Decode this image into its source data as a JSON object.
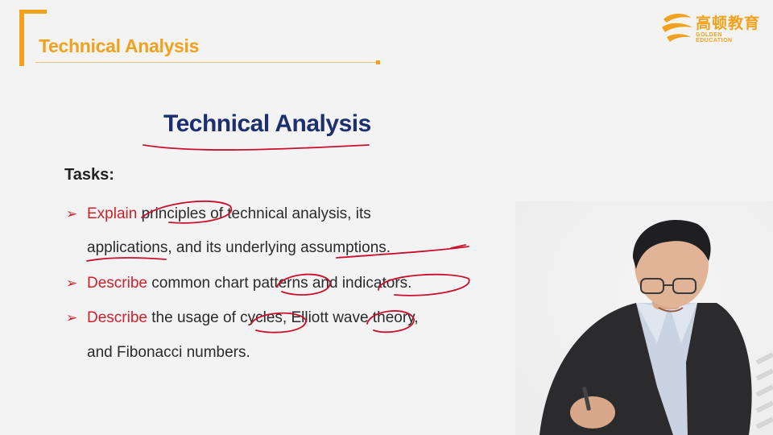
{
  "header": {
    "title": "Technical Analysis"
  },
  "logo": {
    "name_cn": "高顿教育",
    "name_en": "GOLDEN EDUCATION"
  },
  "slide": {
    "title": "Technical Analysis",
    "tasks_label": "Tasks:",
    "tasks": [
      {
        "verb": "Explain",
        "line1": " principles of technical analysis, its",
        "line2": "applications, and its underlying assumptions."
      },
      {
        "verb": "Describe",
        "line1": " common chart patterns and  indicators."
      },
      {
        "verb": "Describe",
        "line1": " the usage of cycles, Elliott wave theory,",
        "line2": "and Fibonacci numbers."
      }
    ]
  },
  "colors": {
    "accent": "#f0a21e",
    "title_navy": "#1c2f6e",
    "verb_red": "#d0202a",
    "ink_red": "#c8102e"
  }
}
